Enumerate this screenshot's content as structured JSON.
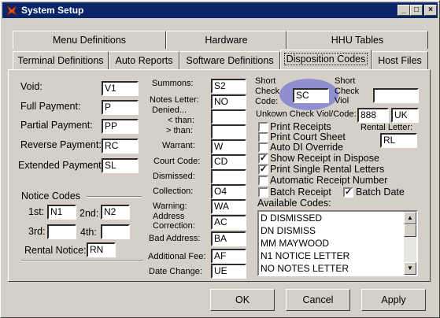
{
  "window": {
    "title": "System Setup",
    "min": "_",
    "max": "□",
    "close": "×"
  },
  "tabs_row1": [
    "Menu Definitions",
    "Hardware",
    "HHU Tables"
  ],
  "tabs_row2": [
    "Terminal Definitions",
    "Auto Reports",
    "Software Definitions",
    "Disposition Codes",
    "Host Files"
  ],
  "left": {
    "void": {
      "label": "Void:",
      "value": "V1"
    },
    "full_payment": {
      "label": "Full Payment:",
      "value": "P"
    },
    "partial_payment": {
      "label": "Partial Payment:",
      "value": "PP"
    },
    "reverse_payment": {
      "label": "Reverse Payment:",
      "value": "RC"
    },
    "extended_payment": {
      "label": "Extended Payment",
      "value": "SL"
    },
    "notice_codes": "Notice Codes",
    "first": {
      "label": "1st:",
      "value": "N1"
    },
    "second": {
      "label": "2nd:",
      "value": "N2"
    },
    "third": {
      "label": "3rd:",
      "value": ""
    },
    "fourth": {
      "label": "4th:",
      "value": ""
    },
    "rental_notice": {
      "label": "Rental Notice:",
      "value": "RN"
    }
  },
  "middle": {
    "summons": {
      "label": "Summons:",
      "value": "S2"
    },
    "notes_letter": {
      "label": "Notes Letter:",
      "value": "NO"
    },
    "denied": {
      "label": "Denied...",
      "value": ""
    },
    "less_than": {
      "label": "< than:",
      "value": ""
    },
    "greater_than": {
      "label": "> than:",
      "value": ""
    },
    "warrant": {
      "label": "Warrant:",
      "value": "W"
    },
    "court_code": {
      "label": "Court Code:",
      "value": "CD"
    },
    "dismissed": {
      "label": "Dismissed:",
      "value": ""
    },
    "collection": {
      "label": "Collection:",
      "value": "O4"
    },
    "warning": {
      "label": "Warning:",
      "value": "WA"
    },
    "address_correction": {
      "label1": "Address",
      "label2": "Correction:",
      "value": "AC"
    },
    "bad_address": {
      "label": "Bad Address:",
      "value": "BA"
    },
    "additional_fee": {
      "label": "Additional Fee:",
      "value": "AF"
    },
    "date_change": {
      "label": "Date Change:",
      "value": "UE"
    }
  },
  "right": {
    "short_check_code": {
      "l1": "Short",
      "l2": "Check",
      "l3": "Code:",
      "value": "SC"
    },
    "short_check_viol": {
      "l1": "Short",
      "l2": "Check",
      "l3": "Viol",
      "value": ""
    },
    "unknown_check": {
      "label": "Unkown Check Viol/Code:",
      "viol": "888",
      "code": "UK"
    },
    "rental_letter": {
      "label": "Rental Letter:",
      "value": "RL"
    },
    "checkboxes": [
      {
        "label": "Print Receipts",
        "checked": false
      },
      {
        "label": "Print Court Sheet",
        "checked": false
      },
      {
        "label": "Auto DI Override",
        "checked": false
      },
      {
        "label": "Show Receipt in Dispose",
        "checked": true
      },
      {
        "label": "Print Single Rental Letters",
        "checked": true
      },
      {
        "label": "Automatic Receipt Number",
        "checked": false
      },
      {
        "label": "Batch Receipt",
        "checked": false
      }
    ],
    "batch_date": {
      "label": "Batch Date",
      "checked": true
    },
    "available_codes_label": "Available Codes:",
    "available_codes": [
      "D  DISMISSED",
      "DN DISMISS",
      "MM MAYWOOD",
      "N1 NOTICE LETTER",
      "NO NOTES LETTER"
    ]
  },
  "buttons": {
    "ok": "OK",
    "cancel": "Cancel",
    "apply": "Apply"
  },
  "colors": {
    "titlebar": "#0a246a",
    "face": "#d4d0c8",
    "highlight": "#8f8fd0"
  }
}
